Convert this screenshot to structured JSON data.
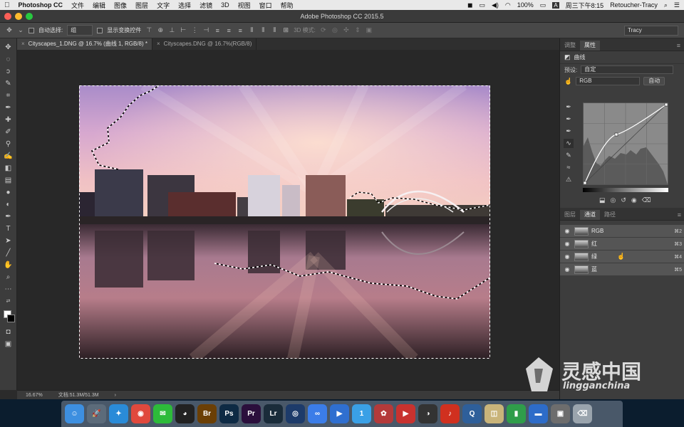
{
  "menubar": {
    "apple": "",
    "app_name": "Photoshop CC",
    "items": [
      "文件",
      "编辑",
      "图像",
      "图层",
      "文字",
      "选择",
      "滤镜",
      "3D",
      "视图",
      "窗口",
      "帮助"
    ],
    "battery": "100%",
    "input_method": "A",
    "clock": "周三下午8:15",
    "user": "Retoucher-Tracy"
  },
  "window": {
    "title": "Adobe Photoshop CC 2015.5"
  },
  "options_bar": {
    "auto_select_label": "自动选择:",
    "auto_select_value": "组",
    "show_transform_label": "显示变换控件",
    "mode_3d_label": "3D 模式:",
    "workspace": "Tracy"
  },
  "documents": {
    "tabs": [
      {
        "title": "Cityscapes_1.DNG @ 16.7% (曲线 1, RGB/8) *",
        "active": true
      },
      {
        "title": "Cityscapes.DNG @ 16.7%(RGB/8)",
        "active": false
      }
    ]
  },
  "status_bar": {
    "zoom": "16.67%",
    "doc_size": "文档:51.3M/51.3M",
    "arrow": "›"
  },
  "properties_panel": {
    "tabs": [
      "调整",
      "属性"
    ],
    "active_tab": "属性",
    "adjustment_name": "曲线",
    "preset_label": "预设:",
    "preset_value": "自定",
    "channel_value": "RGB",
    "auto_button": "自动"
  },
  "channels_panel": {
    "tabs": [
      "图层",
      "通道",
      "路径"
    ],
    "active_tab": "通道",
    "rows": [
      {
        "name": "RGB",
        "shortcut": "⌘2"
      },
      {
        "name": "红",
        "shortcut": "⌘3"
      },
      {
        "name": "绿",
        "shortcut": "⌘4"
      },
      {
        "name": "蓝",
        "shortcut": "⌘5"
      }
    ]
  },
  "watermark": {
    "cn": "灵感中国",
    "en": "lingganchina"
  },
  "dock": {
    "apps": [
      {
        "name": "finder",
        "label": "☺",
        "color": "#3d8fe0"
      },
      {
        "name": "launchpad",
        "label": "🚀",
        "color": "#5c6b7a"
      },
      {
        "name": "safari",
        "label": "✦",
        "color": "#2a8bd8"
      },
      {
        "name": "chrome",
        "label": "◉",
        "color": "#e0493d"
      },
      {
        "name": "wechat",
        "label": "✉",
        "color": "#2dbb3a"
      },
      {
        "name": "qq",
        "label": "◕",
        "color": "#222"
      },
      {
        "name": "bridge",
        "label": "Br",
        "color": "#6b3f05"
      },
      {
        "name": "photoshop",
        "label": "Ps",
        "color": "#0e2a44"
      },
      {
        "name": "premiere",
        "label": "Pr",
        "color": "#2b0f3c"
      },
      {
        "name": "lightroom",
        "label": "Lr",
        "color": "#1a2c3a"
      },
      {
        "name": "cinema4d",
        "label": "◎",
        "color": "#1d3b6a"
      },
      {
        "name": "baidu-netdisk",
        "label": "∞",
        "color": "#3b7de8"
      },
      {
        "name": "video-app",
        "label": "▶",
        "color": "#2f6fd0"
      },
      {
        "name": "tool-1",
        "label": "1",
        "color": "#3aa0e6"
      },
      {
        "name": "davinci",
        "label": "✿",
        "color": "#b43a3a"
      },
      {
        "name": "media-player",
        "label": "▶",
        "color": "#c8322f"
      },
      {
        "name": "obs",
        "label": "◑",
        "color": "#333"
      },
      {
        "name": "netease-music",
        "label": "♪",
        "color": "#d0301f"
      },
      {
        "name": "quicktime",
        "label": "Q",
        "color": "#2e5f9a"
      },
      {
        "name": "preview",
        "label": "◫",
        "color": "#c9b47a"
      },
      {
        "name": "numbers",
        "label": "▮",
        "color": "#2f9d4a"
      },
      {
        "name": "keynote",
        "label": "▬",
        "color": "#2d6cc9"
      },
      {
        "name": "screenshot",
        "label": "▣",
        "color": "#6d6d6d"
      },
      {
        "name": "trash",
        "label": "⌫",
        "color": "#9aa4ad"
      }
    ]
  },
  "colors": {
    "menubar_bg": "#e9e9e9",
    "panel_bg": "#3d3d3d",
    "accent": "#474747"
  }
}
